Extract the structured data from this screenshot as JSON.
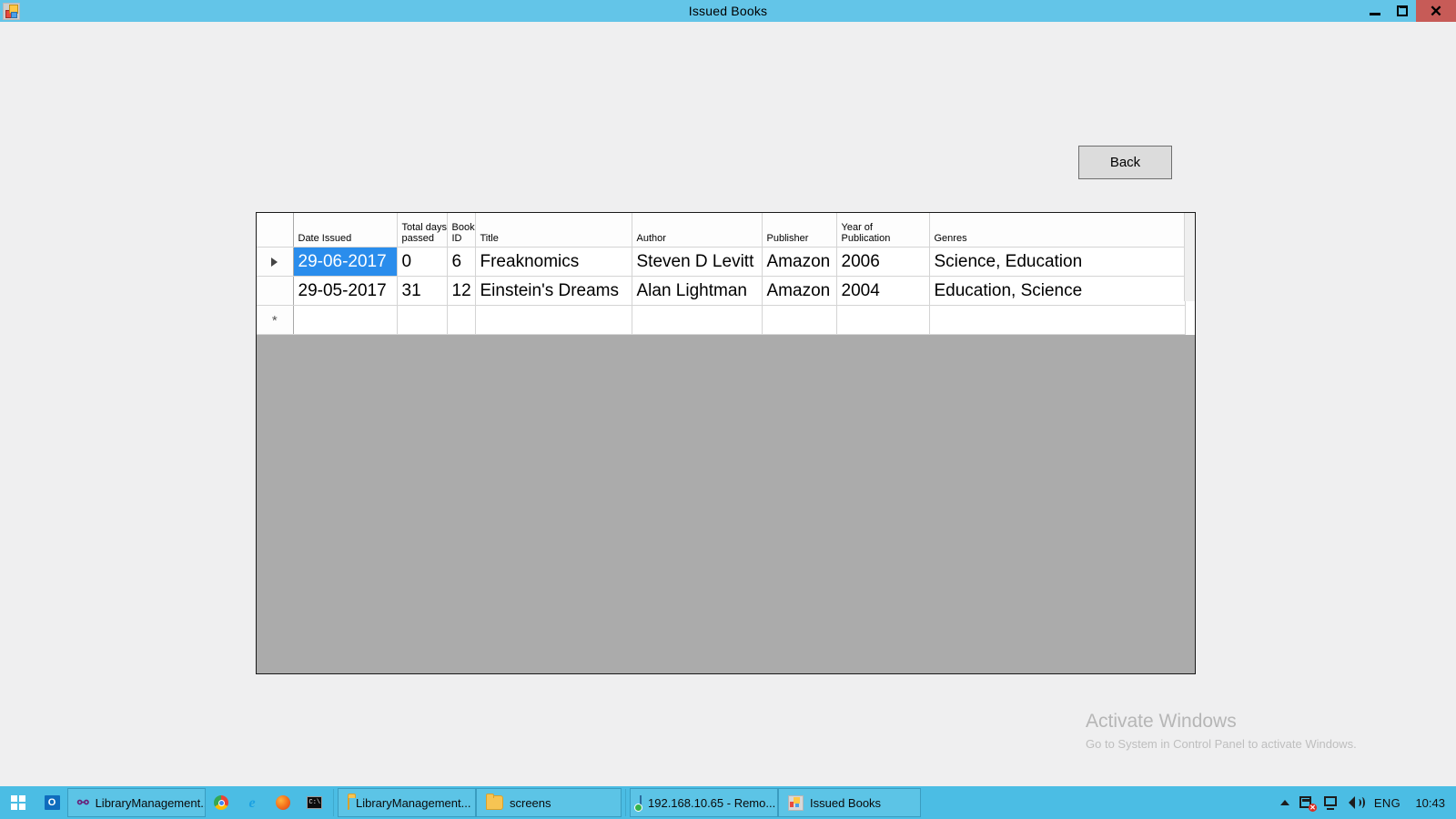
{
  "window": {
    "title": "Issued Books",
    "icon": "app-window-icon",
    "minimize_label": "Minimize",
    "maximize_label": "Restore",
    "close_label": "Close",
    "titlebar_color": "#63c5e8",
    "close_color": "#c75b57"
  },
  "form": {
    "back_label": "Back"
  },
  "grid": {
    "columns": [
      {
        "key": "row_header",
        "label": ""
      },
      {
        "key": "date_issued",
        "label": "Date Issued"
      },
      {
        "key": "total_days_passed",
        "label": "Total days\npassed"
      },
      {
        "key": "book_id",
        "label": "Book\nID"
      },
      {
        "key": "title",
        "label": "Title"
      },
      {
        "key": "author",
        "label": "Author"
      },
      {
        "key": "publisher",
        "label": "Publisher"
      },
      {
        "key": "year_of_publication",
        "label": "Year of\nPublication"
      },
      {
        "key": "genres",
        "label": "Genres"
      }
    ],
    "column_labels": {
      "date_issued": "Date Issued",
      "total_days_passed_line1": "Total days",
      "total_days_passed_line2": "passed",
      "book_id_line1": "Book",
      "book_id_line2": "ID",
      "title": "Title",
      "author": "Author",
      "publisher": "Publisher",
      "year_line1": "Year of",
      "year_line2": "Publication",
      "genres": "Genres"
    },
    "rows": [
      {
        "indicator": "current-row-arrow",
        "selected_cell": "date_issued",
        "date_issued": "29-06-2017",
        "total_days_passed": "0",
        "book_id": "6",
        "title": "Freaknomics",
        "author": "Steven D Levitt",
        "publisher": "Amazon",
        "year_of_publication": "2006",
        "genres": "Science, Education"
      },
      {
        "indicator": "",
        "selected_cell": "",
        "date_issued": "29-05-2017",
        "total_days_passed": "31",
        "book_id": "12",
        "title": "Einstein's Dreams",
        "author": "Alan Lightman",
        "publisher": "Amazon",
        "year_of_publication": "2004",
        "genres": "Education, Science"
      }
    ],
    "new_row_indicator": "*",
    "selection_color": "#2a8dec",
    "background_color": "#ababab"
  },
  "watermark": {
    "title": "Activate Windows",
    "subtitle": "Go to System in Control Panel to activate Windows."
  },
  "taskbar": {
    "start_label": "Start",
    "quick_launch": [
      {
        "name": "outlook-icon",
        "glyph": "O"
      }
    ],
    "buttons": [
      {
        "name": "taskbar-item-librarymanagement-vs",
        "label": "LibraryManagement...",
        "icon": "visual-studio-icon",
        "active": true
      },
      {
        "name": "taskbar-item-chrome",
        "label": "",
        "icon": "chrome-icon",
        "active": false
      },
      {
        "name": "taskbar-item-internet-explorer",
        "label": "",
        "icon": "internet-explorer-icon",
        "active": false
      },
      {
        "name": "taskbar-item-firefox",
        "label": "",
        "icon": "firefox-icon",
        "active": false
      },
      {
        "name": "taskbar-item-command-prompt",
        "label": "",
        "icon": "command-prompt-icon",
        "active": false
      },
      {
        "name": "taskbar-item-librarymanagement-folder",
        "label": "LibraryManagement...",
        "icon": "folder-icon",
        "active": true
      },
      {
        "name": "taskbar-item-screens",
        "label": "screens",
        "icon": "folder-icon",
        "active": true
      },
      {
        "name": "taskbar-item-remote-desktop",
        "label": "192.168.10.65 - Remo...",
        "icon": "remote-desktop-icon",
        "active": true
      },
      {
        "name": "taskbar-item-issued-books",
        "label": "Issued Books",
        "icon": "app-window-icon",
        "active": true
      }
    ],
    "labels": {
      "lib_vs": "LibraryManagement...",
      "lib_folder": "LibraryManagement...",
      "screens": "screens",
      "remote": "192.168.10.65 - Remo...",
      "issued": "Issued Books"
    },
    "tray": {
      "show_hidden_label": "Show hidden icons",
      "action_center": "action-center-icon",
      "network": "network-icon",
      "volume": "volume-icon",
      "language": "ENG",
      "clock": "10:43"
    },
    "color": "#4bbde4"
  }
}
